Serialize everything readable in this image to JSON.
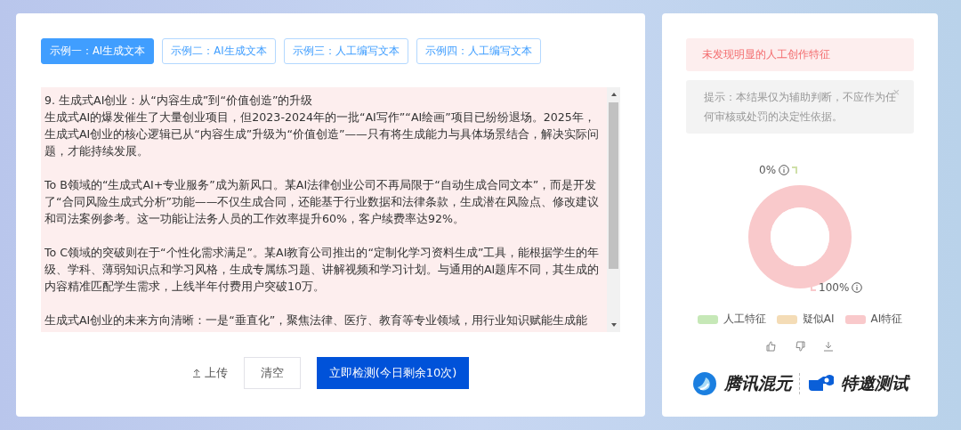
{
  "examples": [
    {
      "label": "示例一：AI生成文本",
      "selected": true
    },
    {
      "label": "示例二：AI生成文本",
      "selected": false
    },
    {
      "label": "示例三：人工编写文本",
      "selected": false
    },
    {
      "label": "示例四：人工编写文本",
      "selected": false
    }
  ],
  "editor": {
    "title": "9. 生成式AI创业：从“内容生成”到“价值创造”的升级",
    "paragraphs": [
      "生成式AI的爆发催生了大量创业项目，但2023-2024年的一批“AI写作”“AI绘画”项目已纷纷退场。2025年，生成式AI创业的核心逻辑已从“内容生成”升级为“价值创造”——只有将生成能力与具体场景结合，解决实际问题，才能持续发展。",
      "To B领域的“生成式AI+专业服务”成为新风口。某AI法律创业公司不再局限于“自动生成合同文本”，而是开发了“合同风险生成式分析”功能——不仅生成合同，还能基于行业数据和法律条款，生成潜在风险点、修改建议和司法案例参考。这一功能让法务人员的工作效率提升60%，客户续费率达92%。",
      "To C领域的突破则在于“个性化需求满足”。某AI教育公司推出的“定制化学习资料生成”工具，能根据学生的年级、学科、薄弱知识点和学习风格，生成专属练习题、讲解视频和学习计划。与通用的AI题库不同，其生成的内容精准匹配学生需求，上线半年付费用户突破10万。",
      "生成式AI创业的未来方向清晰：一是“垂直化”，聚焦法律、医疗、教育等专业领域，用行业知识赋能生成能"
    ]
  },
  "actions": {
    "upload": "上传",
    "clear": "清空",
    "detect": "立即检测(今日剩余10次)"
  },
  "result": {
    "verdict": "未发现明显的人工创作特征",
    "notice": "提示：本结果仅为辅助判断，不应作为任何审核或处罚的决定性依据。",
    "close": "×"
  },
  "chart": {
    "chart_data": {
      "type": "donut",
      "categories": [
        "人工特征",
        "疑似AI",
        "AI特征"
      ],
      "values": [
        0,
        0,
        100
      ]
    },
    "labels": [
      {
        "text": "0%",
        "color": "#cfe0a8"
      },
      {
        "text": "100%",
        "color": "#f9c9cb"
      }
    ],
    "legend": [
      {
        "color": "#c6e8b7"
      },
      {
        "color": "#f4dcb6"
      },
      {
        "color": "#f9c9cb"
      }
    ]
  },
  "brand": {
    "name": "腾讯混元",
    "tag": "特邀测试"
  }
}
